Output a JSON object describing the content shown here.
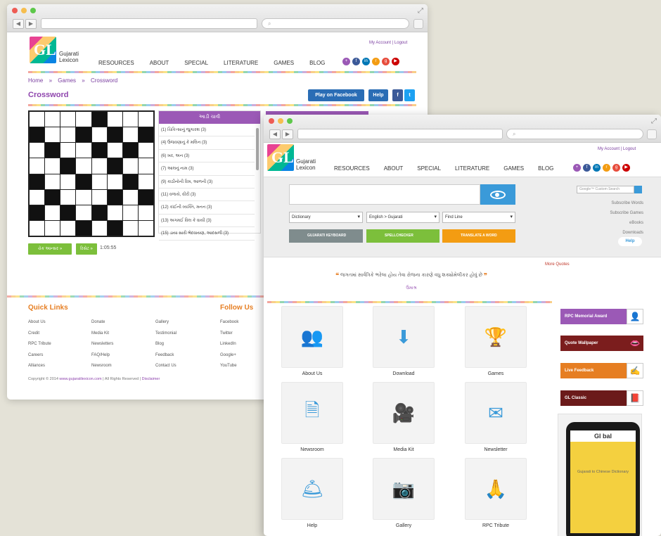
{
  "window1": {
    "url": "",
    "account_links": "My Account | Logout",
    "brand_line1": "Gujarati",
    "brand_line2": "Lexicon",
    "logo_text": "GL",
    "menu": [
      "RESOURCES",
      "ABOUT",
      "SPECIAL",
      "LITERATURE",
      "GAMES",
      "BLOG"
    ],
    "breadcrumb": [
      "Home",
      "»",
      "Games",
      "»",
      "Crossword"
    ],
    "page_title": "Crossword",
    "play_facebook": "Play on Facebook",
    "help": "Help",
    "clues_header": "આડી ચાવી",
    "clues": [
      "(1) ચિકિત્સાનું જુગારશ (3)",
      "(4) ઉજવણાનું કે મલિન (3)",
      "(6) ખર, અન (3)",
      "(7) આલનું નામ (3)",
      "(9) કાઠીનોની રિમ, આળની (3)",
      "(11) વળાયે, વીરી (3)",
      "(12) કાંઈની વ્યક્તિ, મનન (3)",
      "(13) અગમઈ વિલ કે વાયી (3)",
      "(15) ડાયા સારી ભેદવાયણ, આદસળી (3)"
    ],
    "check_answer": "ચેક આન્સર »",
    "reset": "રિસેટ »",
    "timer": "1:05:55",
    "footer": {
      "quick_links_title": "Quick Links",
      "follow_us_title": "Follow Us",
      "col1": [
        "About Us",
        "Credit",
        "RPC Tribute",
        "Careers",
        "Alliances"
      ],
      "col2": [
        "Donate",
        "Media Kit",
        "Newsletters",
        "FAQ/Help",
        "Newsroom"
      ],
      "col3": [
        "Gallery",
        "Testimonial",
        "Blog",
        "Feedback",
        "Contact Us"
      ],
      "col4": [
        "Facebook",
        "Twitter",
        "LinkedIn",
        "Google+",
        "YouTube"
      ],
      "copyright_prefix": "Copyright © 2014",
      "copyright_site": "www.gujaratilexicon.com",
      "copyright_suffix": "| All Rights Reserved |",
      "disclaimer": "Disclaimer"
    }
  },
  "window2": {
    "account_links": "My Account | Logout",
    "brand_line1": "Gujarati",
    "brand_line2": "Lexicon",
    "logo_text": "GL",
    "menu": [
      "RESOURCES",
      "ABOUT",
      "SPECIAL",
      "LITERATURE",
      "GAMES",
      "BLOG"
    ],
    "search_placeholder": "",
    "selects": [
      "Dictionary",
      "English > Gujarati",
      "Find Line"
    ],
    "tools": [
      "GUJARATI KEYBOARD",
      "SPELLCHECKER",
      "TRANSLATE A WORD"
    ],
    "mini_search_placeholder": "Google™ Custom Search",
    "right_links": [
      "Subscribe Words",
      "Subscribe Games",
      "eBooks",
      "Downloads"
    ],
    "help": "Help",
    "more_quotes": "More Quotes",
    "quote": "જગતમાં સાર્વત્રિકે ભરેલા હોય તેવા રોજના કારણે વધુ શક્યોમેલીકર હોવું છે",
    "quote_author": "ઉમાશ્ર",
    "tiles": [
      {
        "label": "About Us",
        "icon": "users-icon"
      },
      {
        "label": "Download",
        "icon": "download-icon"
      },
      {
        "label": "Games",
        "icon": "trophy-icon"
      },
      {
        "label": "Newsroom",
        "icon": "documents-icon"
      },
      {
        "label": "Media Kit",
        "icon": "video-camera-icon"
      },
      {
        "label": "Newsletter",
        "icon": "mail-icon"
      },
      {
        "label": "Help",
        "icon": "service-bell-icon"
      },
      {
        "label": "Gallery",
        "icon": "camera-icon"
      },
      {
        "label": "RPC Tribute",
        "icon": "praying-hands-icon"
      }
    ],
    "side_buttons": [
      {
        "label": "RPC Memorial Award",
        "color": "#9b59b6"
      },
      {
        "label": "Quote Wallpaper",
        "color": "#7b1d1d"
      },
      {
        "label": "Live Feedback",
        "color": "#e67e22"
      },
      {
        "label": "GL Classic",
        "color": "#6b1a1a"
      }
    ],
    "phone_title": "Gl bal",
    "phone_text": "Gujarati to Chinese Dictionary"
  },
  "colors": {
    "purple": "#8e44ad",
    "blue": "#3a9ad9",
    "green": "#7cbf3b",
    "orange": "#e67e22"
  }
}
